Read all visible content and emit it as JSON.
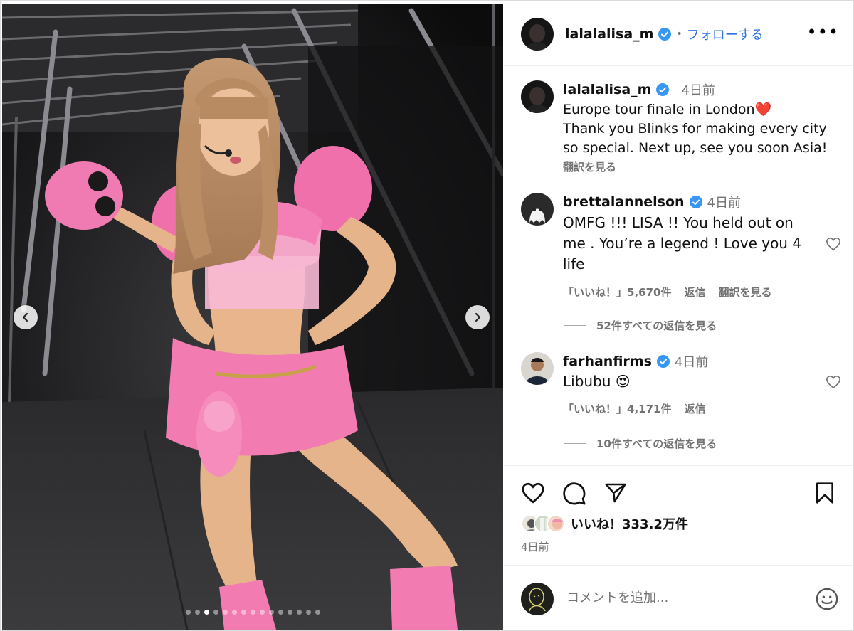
{
  "post": {
    "author": "lalalalisa_m",
    "follow_label": "フォローする",
    "dot_separator": "•",
    "more_label": "•••",
    "caption_time": "4日前",
    "caption_line1": "Europe tour finale in London❤️",
    "caption_line2": "Thank you Blinks for making every city so special. Next up, see you soon Asia!",
    "see_translation": "翻訳を見る"
  },
  "comments": [
    {
      "username": "brettalannelson",
      "time": "4日前",
      "text": "OMFG !!! LISA !! You held out on me . You’re a legend ! Love you 4 life",
      "likes": "「いいね！」5,670件",
      "reply": "返信",
      "translate": "翻訳を見る",
      "view_replies": "52件すべての返信を見る"
    },
    {
      "username": "farhanfirms",
      "time": "4日前",
      "text": "Libubu 😍",
      "likes": "「いいね！」4,171件",
      "reply": "返信",
      "view_replies": "10件すべての返信を見る"
    }
  ],
  "engagement": {
    "likes_summary": "いいね！333.2万件",
    "date": "4日前"
  },
  "comment_box": {
    "placeholder": "コメントを追加..."
  },
  "carousel": {
    "total_slides": 15,
    "current_slide": 3
  },
  "colors": {
    "verified_blue": "#3897f0",
    "link_blue": "#2f6fde",
    "muted_text": "#737373",
    "outfit_pink": "#f06aa8"
  },
  "icons": {
    "like": "heart-icon",
    "comment": "comment-bubble-icon",
    "share": "paper-plane-icon",
    "save": "bookmark-icon",
    "emoji": "smiley-icon",
    "prev": "chevron-left-icon",
    "next": "chevron-right-icon",
    "verified": "verified-badge-icon"
  }
}
